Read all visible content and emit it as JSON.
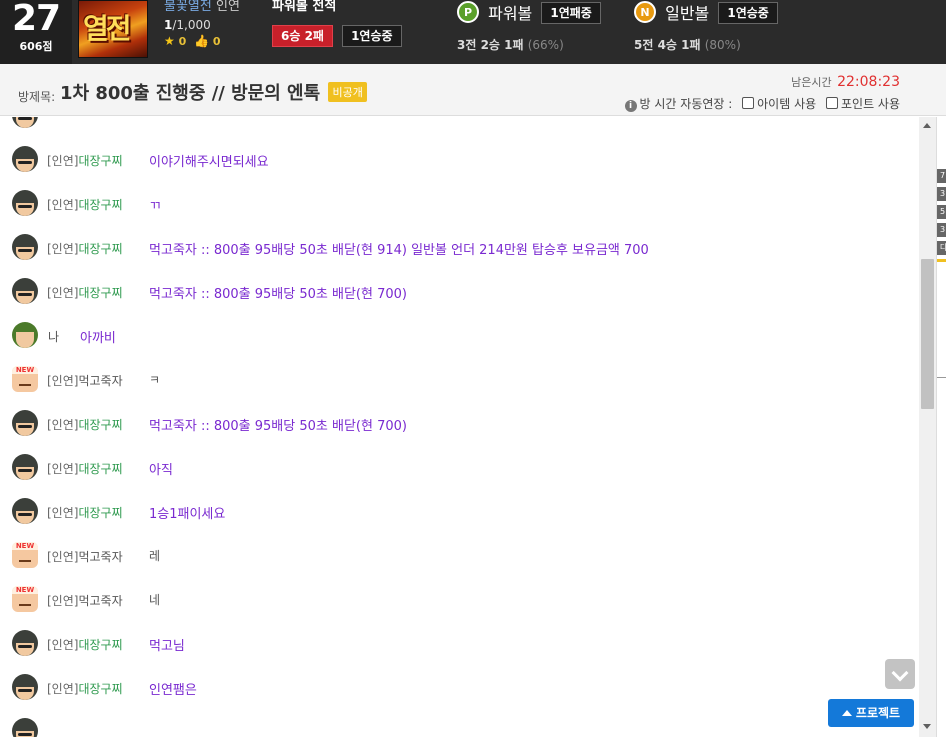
{
  "user": {
    "level": "27",
    "points": "606점",
    "nickname": "불꽃열전",
    "status": "인연",
    "count_current": "1",
    "count_total": "/1,000",
    "stars": "0",
    "likes": "0",
    "avatar_text": "열전"
  },
  "powerball_record": {
    "title": "파워볼 전적",
    "summary": "6승 2패",
    "streak": "1연승중"
  },
  "power_ball": {
    "icon_letter": "P",
    "label": "파워볼",
    "streak": "1연패중",
    "record": "3전 2승 1패",
    "pct": "(66%)"
  },
  "normal_ball": {
    "icon_letter": "N",
    "label": "일반볼",
    "streak": "1연승중",
    "record": "5전 4승 1패",
    "pct": "(80%)"
  },
  "room": {
    "label": "방제목:",
    "title": "1차 800출 진행중 // 방문의 엔톡",
    "private_badge": "비공개",
    "time_label": "남은시간",
    "time_value": "22:08:23",
    "auto_extend_label": "방 시간 자동연장 :",
    "item_option": "아이템 사용",
    "point_option": "포인트 사용"
  },
  "messages": [
    {
      "avatar": "cap",
      "rank": "[인연]",
      "name": "대장구찌",
      "name_color": "green",
      "text": "이야기해주시면되세요",
      "text_color": "purple"
    },
    {
      "avatar": "cap",
      "rank": "[인연]",
      "name": "대장구찌",
      "name_color": "green",
      "text": "ㄲ",
      "text_color": "purple"
    },
    {
      "avatar": "cap",
      "rank": "[인연]",
      "name": "대장구찌",
      "name_color": "green",
      "text": "먹고죽자 :: 800출 95배당 50초 배닫(현 914) 일반볼 언더 214만원 탑승후 보유금액 700",
      "text_color": "purple"
    },
    {
      "avatar": "cap",
      "rank": "[인연]",
      "name": "대장구찌",
      "name_color": "green",
      "text": "먹고죽자 :: 800출 95배당 50초 배닫(현 700)",
      "text_color": "purple"
    },
    {
      "avatar": "me",
      "rank": "",
      "name": "나",
      "name_color": "gray",
      "text": "아까비",
      "text_color": "purple",
      "self": true
    },
    {
      "avatar": "new",
      "rank": "[인연]",
      "name": "먹고죽자",
      "name_color": "gray",
      "text": "ㅋ",
      "text_color": "gray"
    },
    {
      "avatar": "cap",
      "rank": "[인연]",
      "name": "대장구찌",
      "name_color": "green",
      "text": "먹고죽자 :: 800출 95배당 50초 배닫(현 700)",
      "text_color": "purple"
    },
    {
      "avatar": "cap",
      "rank": "[인연]",
      "name": "대장구찌",
      "name_color": "green",
      "text": "아직",
      "text_color": "purple"
    },
    {
      "avatar": "cap",
      "rank": "[인연]",
      "name": "대장구찌",
      "name_color": "green",
      "text": "1승1패이세요",
      "text_color": "purple"
    },
    {
      "avatar": "new",
      "rank": "[인연]",
      "name": "먹고죽자",
      "name_color": "gray",
      "text": "레",
      "text_color": "gray"
    },
    {
      "avatar": "new",
      "rank": "[인연]",
      "name": "먹고죽자",
      "name_color": "gray",
      "text": "네",
      "text_color": "gray"
    },
    {
      "avatar": "cap",
      "rank": "[인연]",
      "name": "대장구찌",
      "name_color": "green",
      "text": "먹고님",
      "text_color": "purple"
    },
    {
      "avatar": "cap",
      "rank": "[인연]",
      "name": "대장구찌",
      "name_color": "green",
      "text": "인연팸은",
      "text_color": "purple"
    }
  ],
  "side_tags": [
    "7",
    "3",
    "5",
    "3",
    "다"
  ],
  "protect_button": "프로젝트",
  "colors": {
    "topbar_bg": "#2b2b2b",
    "message_purple": "#7a2ad0",
    "name_green": "#2f9a4f",
    "badge_red": "#c8202a",
    "timer_red": "#e03030",
    "protect_blue": "#1479d9"
  },
  "icons": {
    "star": "star-icon",
    "like": "thumbs-up-icon",
    "info": "info-icon",
    "scroll_down": "chevron-down-icon",
    "protect": "triangle-up-icon"
  }
}
